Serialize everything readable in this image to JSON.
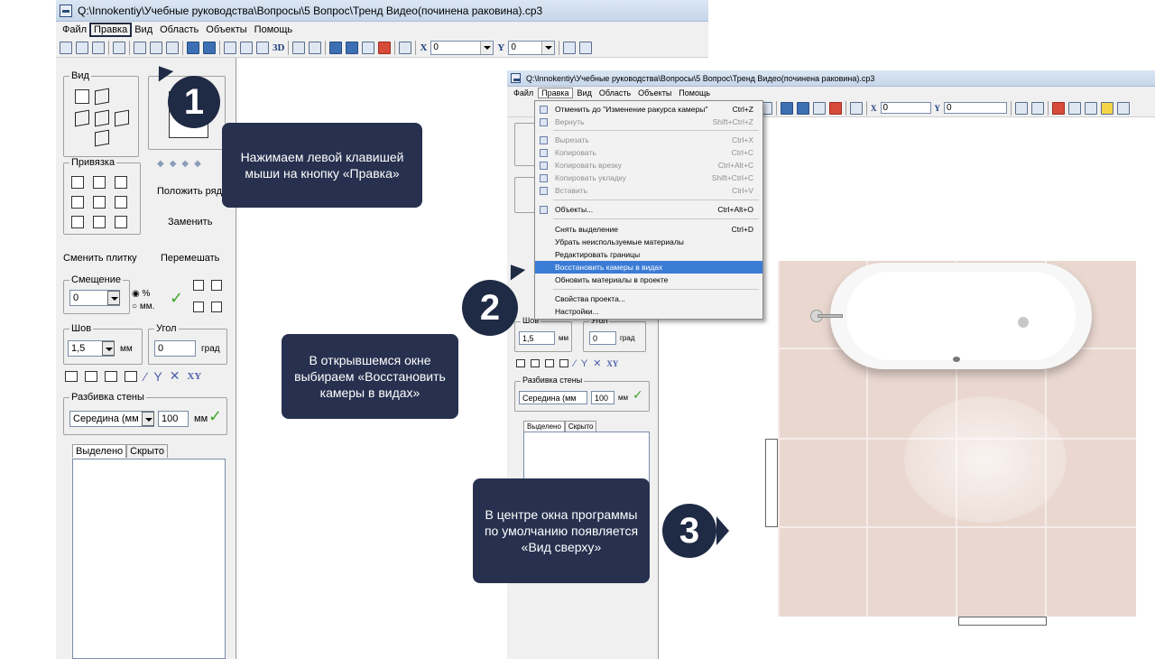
{
  "window": {
    "title": "Q:\\Innokentiy\\Учебные руководства\\Вопросы\\5 Вопрос\\Тренд Видео(починена раковина).cp3"
  },
  "menubar": [
    "Файл",
    "Правка",
    "Вид",
    "Область",
    "Объекты",
    "Помощь"
  ],
  "toolbar": {
    "x_label": "X",
    "x_value": "0",
    "y_label": "Y",
    "y_value": "0",
    "btn_3d": "3D"
  },
  "panel": {
    "view_group": "Вид",
    "snap_group": "Привязка",
    "lay_row": "Положить ряд",
    "replace": "Заменить",
    "change_tile": "Сменить плитку",
    "shuffle": "Перемешать",
    "offset_group": "Смещение",
    "offset_value": "0",
    "pct": "%",
    "mm_radio": "мм.",
    "seam_group": "Шов",
    "seam_value": "1,5",
    "seam_unit": "мм",
    "angle_group": "Угол",
    "angle_value": "0",
    "angle_unit": "град",
    "xy": "XY",
    "wall_split": "Разбивка стены",
    "split_value": "Середина (мм",
    "split_num": "100",
    "split_unit": "мм",
    "tab_selected": "Выделено",
    "tab_hidden": "Скрыто"
  },
  "edit_menu": [
    {
      "label": "Отменить до \"Изменение ракурса камеры\"",
      "shortcut": "Ctrl+Z",
      "state": "normal"
    },
    {
      "label": "Вернуть",
      "shortcut": "Shift+Ctrl+Z",
      "state": "disabled"
    },
    {
      "label": "Вырезать",
      "shortcut": "Ctrl+X",
      "state": "disabled"
    },
    {
      "label": "Копировать",
      "shortcut": "Ctrl+C",
      "state": "disabled"
    },
    {
      "label": "Копировать врезку",
      "shortcut": "Ctrl+Alt+C",
      "state": "disabled"
    },
    {
      "label": "Копировать укладку",
      "shortcut": "Shift+Ctrl+C",
      "state": "disabled"
    },
    {
      "label": "Вставить",
      "shortcut": "Ctrl+V",
      "state": "disabled"
    },
    {
      "label": "Объекты...",
      "shortcut": "Ctrl+Alt+O",
      "state": "normal"
    },
    {
      "label": "Снять выделение",
      "shortcut": "Ctrl+D",
      "state": "normal"
    },
    {
      "label": "Убрать неиспользуемые материалы",
      "shortcut": "",
      "state": "normal"
    },
    {
      "label": "Редактировать границы",
      "shortcut": "",
      "state": "normal"
    },
    {
      "label": "Восстановить камеры в видах",
      "shortcut": "",
      "state": "selected"
    },
    {
      "label": "Обновить материалы в проекте",
      "shortcut": "",
      "state": "normal"
    },
    {
      "label": "Свойства проекта...",
      "shortcut": "",
      "state": "normal"
    },
    {
      "label": "Настройки...",
      "shortcut": "",
      "state": "normal"
    }
  ],
  "steps": [
    {
      "number": "1",
      "text": "Нажимаем левой клавишей мыши на кнопку «Правка»"
    },
    {
      "number": "2",
      "text": "В открывшемся окне выбираем «Восстановить камеры в видах»"
    },
    {
      "number": "3",
      "text": "В центре окна программы по умолчанию появляется «Вид сверху»"
    }
  ],
  "colors": {
    "accent": "#1f2a44",
    "callout": "#27314f",
    "menu_selected": "#3a7bd5",
    "tile": "#ead8d0",
    "check": "#3fa52a"
  }
}
